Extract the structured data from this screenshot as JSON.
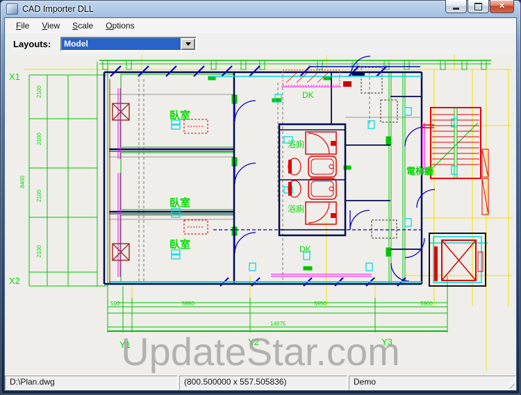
{
  "window": {
    "title": "CAD Importer DLL"
  },
  "menu": {
    "items": [
      {
        "label": "File"
      },
      {
        "label": "View"
      },
      {
        "label": "Scale"
      },
      {
        "label": "Options"
      }
    ]
  },
  "toolbar": {
    "label": "Layouts:",
    "selected_layout": "Model"
  },
  "canvas": {
    "watermark": "UpdateStar.com",
    "axis": {
      "x1": "X1",
      "x2": "X2",
      "y1": "Y1",
      "y2": "Y2",
      "y3": "Y3"
    },
    "rooms": {
      "bedroom": "臥室",
      "bath": "浴廁",
      "dk": "DK",
      "elevator_hall": "電梯廳"
    },
    "dims": {
      "left_a": "2100",
      "left_b": "2100",
      "left_span": "8400",
      "left_c": "2100",
      "left_d": "2100",
      "bottom_a": "550",
      "bottom_b": "5950",
      "bottom_c": "5950",
      "bottom_d": "5900",
      "bottom_total": "14975"
    }
  },
  "statusbar": {
    "file": "D:\\Plan.dwg",
    "coords": "(800.500000 x 557.505836)",
    "mode": "Demo"
  },
  "colors": {
    "selection": "#2a63c8",
    "cad_green": "#00c400",
    "cad_cyan": "#00e0e0",
    "cad_red": "#e00000",
    "cad_yellow": "#f0e000",
    "cad_magenta": "#ff00ff",
    "cad_blue": "#0000cd",
    "watermark_gray": "#9a9a9a"
  }
}
